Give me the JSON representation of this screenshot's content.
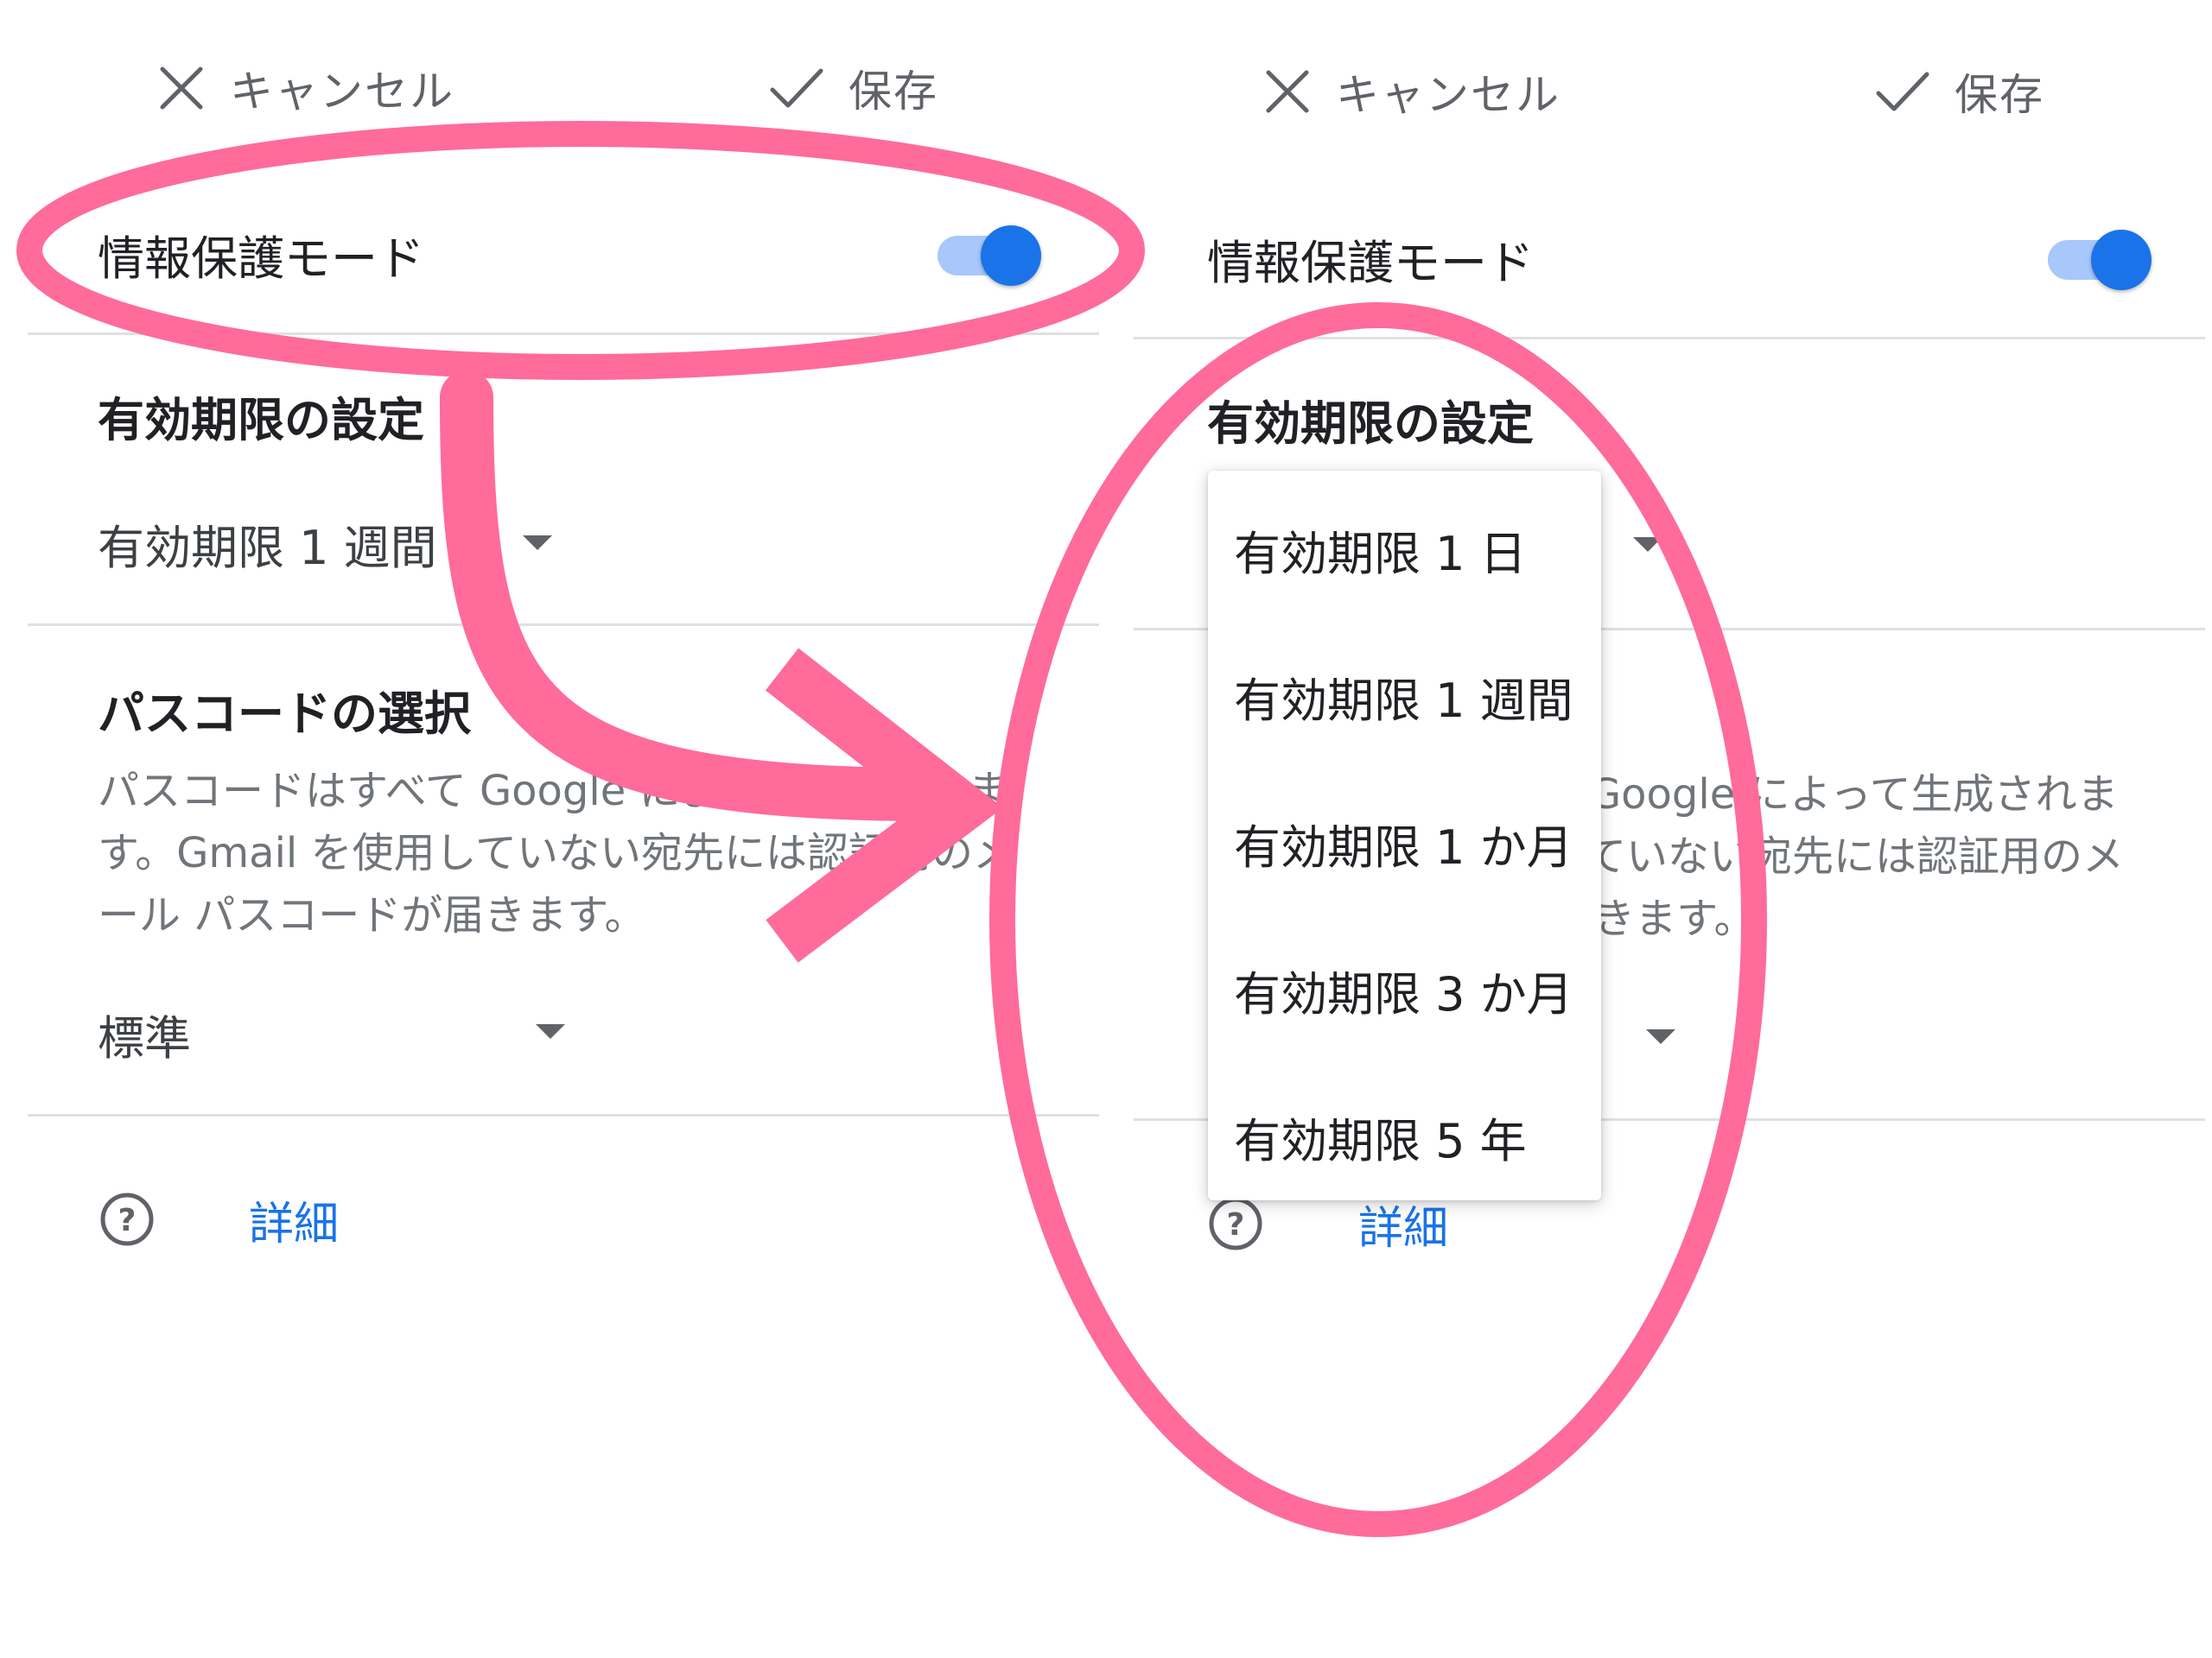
{
  "colors": {
    "accent_blue": "#1a73e8",
    "toggle_track": "#a8c7fa",
    "highlight_pink": "#ff6b9a",
    "divider": "#e0e0e0"
  },
  "left_panel": {
    "toolbar": {
      "cancel_icon": "close-icon",
      "cancel_label": "キャンセル",
      "save_icon": "check-icon",
      "save_label": "保存"
    },
    "confidential_mode": {
      "label": "情報保護モード",
      "enabled": true
    },
    "expiry": {
      "title": "有効期限の設定",
      "selected": "有効期限 1 週間"
    },
    "passcode": {
      "title": "パスコードの選択",
      "description_lines": [
        "パスコードはすべて Google によって生成されま",
        "す。Gmail を使用していない宛先には認証用のメ",
        "ール パスコードが届きます。"
      ],
      "selected": "標準"
    },
    "help": {
      "icon": "help-circle-icon",
      "link_label": "詳細"
    }
  },
  "right_panel": {
    "toolbar": {
      "cancel_icon": "close-icon",
      "cancel_label": "キャンセル",
      "save_icon": "check-icon",
      "save_label": "保存"
    },
    "confidential_mode": {
      "label": "情報保護モード",
      "enabled": true
    },
    "expiry": {
      "title": "有効期限の設定",
      "options": [
        "有効期限 1 日",
        "有効期限 1 週間",
        "有効期限 1 か月",
        "有効期限 3 か月",
        "有効期限 5 年"
      ]
    },
    "passcode": {
      "description_lines": [
        "パスコードはすべて Google によって生成されま",
        "す。Gmail を使用していない宛先には認証用のメ",
        "ール パスコードが届きます。"
      ]
    },
    "help": {
      "icon": "help-circle-icon",
      "link_label": "詳細"
    }
  }
}
